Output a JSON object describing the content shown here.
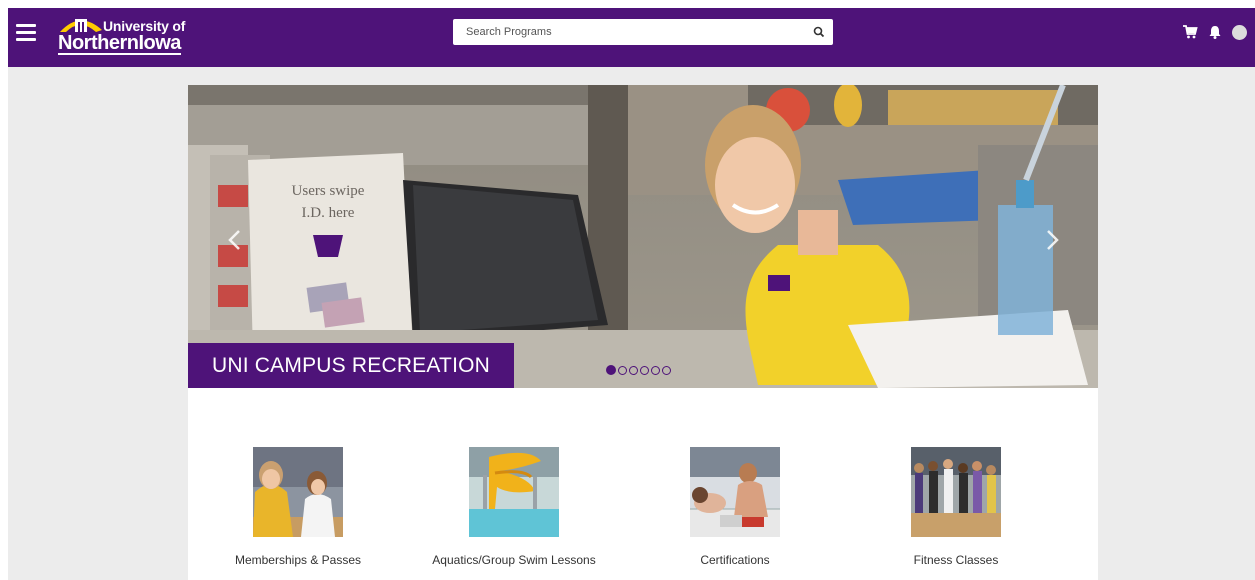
{
  "header": {
    "logo_top": "University of",
    "logo_bottom": "NorthernIowa",
    "search_placeholder": "Search Programs",
    "icons": [
      "menu-icon",
      "cart-icon",
      "bell-icon",
      "avatar"
    ]
  },
  "carousel": {
    "caption": "UNI CAMPUS RECREATION",
    "slide_count": 6,
    "active_slide": 1,
    "sign_line1": "Users swipe",
    "sign_line2": "I.D. here"
  },
  "programs": [
    {
      "label": "Memberships & Passes"
    },
    {
      "label": "Aquatics/Group Swim Lessons"
    },
    {
      "label": "Certifications"
    },
    {
      "label": "Fitness Classes"
    }
  ],
  "colors": {
    "brand_purple": "#4e1379",
    "brand_gold": "#ffcc00"
  }
}
